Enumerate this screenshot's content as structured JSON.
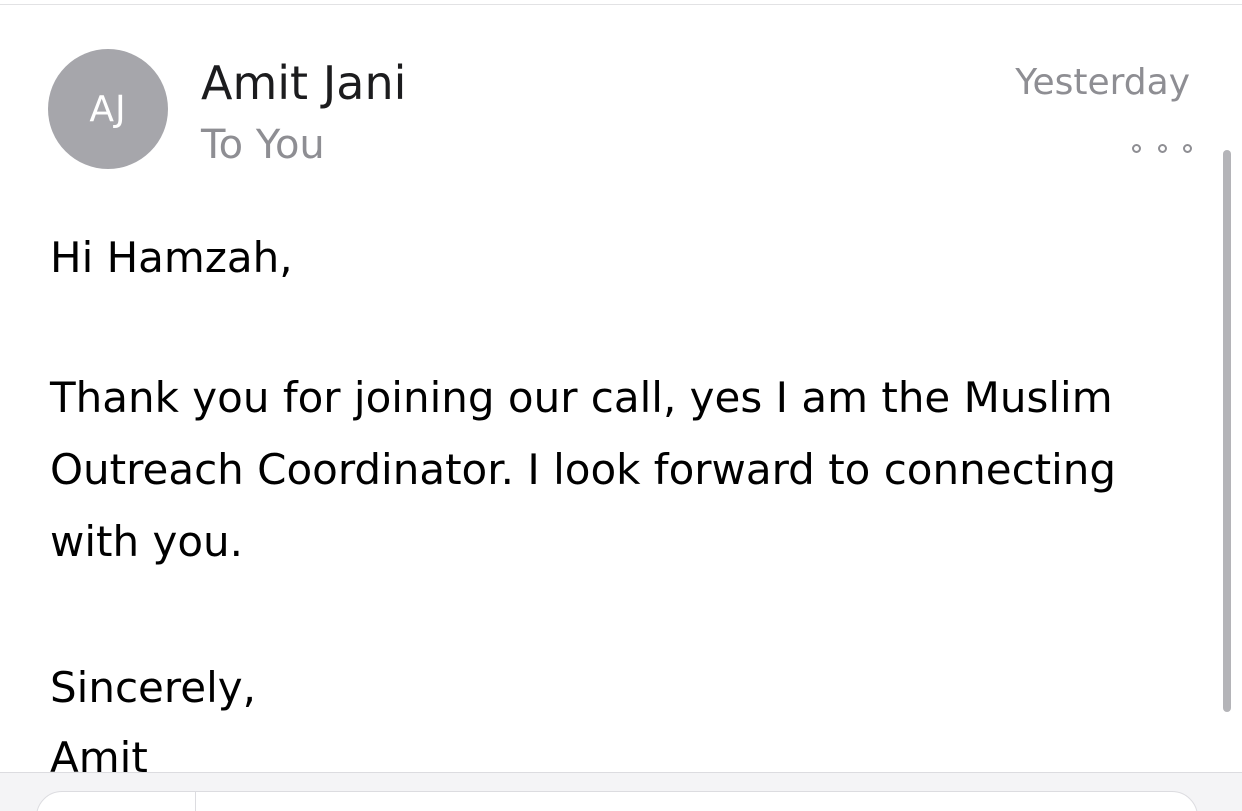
{
  "message": {
    "avatar_initials": "AJ",
    "sender_name": "Amit Jani",
    "recipient_line": "To You",
    "timestamp": "Yesterday",
    "more_icon": "ellipsis-icon",
    "body_lines": [
      "Hi Hamzah,",
      "Thank you for joining our call, yes I am the Muslim",
      "Outreach Coordinator. I look forward to connecting",
      "with you.",
      "Sincerely,",
      "Amit"
    ]
  },
  "colors": {
    "avatar_bg": "#a6a6ab",
    "secondary_text": "#8e8e93",
    "primary_text": "#1c1c1e"
  }
}
